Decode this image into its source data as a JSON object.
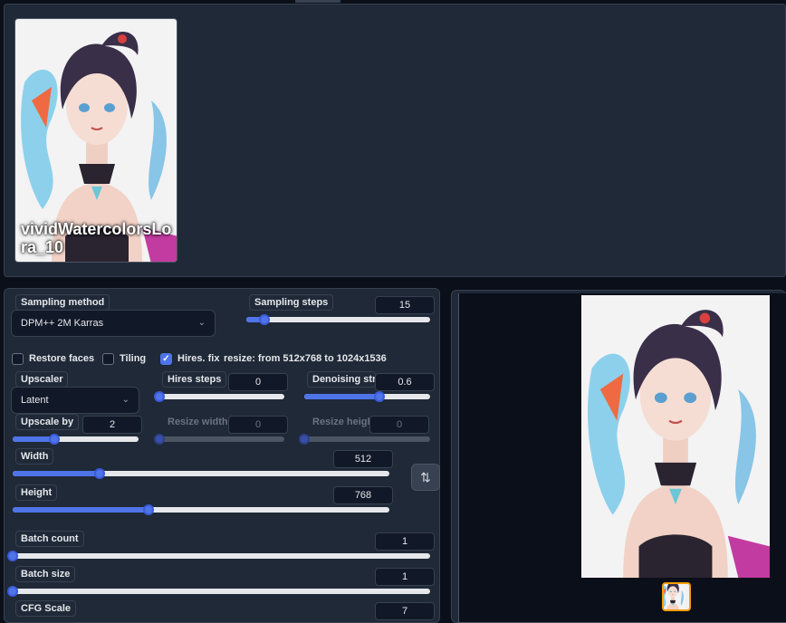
{
  "lora_card": {
    "name": "vividWatercolorsLora_10"
  },
  "sampling": {
    "method_label": "Sampling method",
    "method_value": "DPM++ 2M Karras",
    "steps_label": "Sampling steps",
    "steps_value": "15",
    "steps_fraction": 0.1
  },
  "options": {
    "restore_faces": {
      "label": "Restore faces",
      "checked": false
    },
    "tiling": {
      "label": "Tiling",
      "checked": false
    },
    "hires_fix": {
      "label": "Hires. fix",
      "checked": true
    },
    "resize_info": "resize: from 512x768 to 1024x1536"
  },
  "hires": {
    "upscaler_label": "Upscaler",
    "upscaler_value": "Latent",
    "steps_label": "Hires steps",
    "steps_value": "0",
    "steps_fraction": 0,
    "denoise_label": "Denoising strength",
    "denoise_value": "0.6",
    "denoise_fraction": 0.6,
    "upscale_by_label": "Upscale by",
    "upscale_by_value": "2",
    "upscale_by_fraction": 0.33,
    "resize_width_label": "Resize width to",
    "resize_width_value": "0",
    "resize_height_label": "Resize height to",
    "resize_height_value": "0"
  },
  "size": {
    "width_label": "Width",
    "width_value": "512",
    "width_fraction": 0.23,
    "height_label": "Height",
    "height_value": "768",
    "height_fraction": 0.36,
    "swap_icon": "swap-arrows-icon"
  },
  "batch": {
    "count_label": "Batch count",
    "count_value": "1",
    "count_fraction": 0,
    "size_label": "Batch size",
    "size_value": "1",
    "size_fraction": 0
  },
  "cfg": {
    "label": "CFG Scale",
    "value": "7"
  },
  "colors": {
    "accent": "#4f74e8",
    "panel": "#1f2937",
    "background": "#0b0f19",
    "selected_thumb": "#f59e0b"
  }
}
